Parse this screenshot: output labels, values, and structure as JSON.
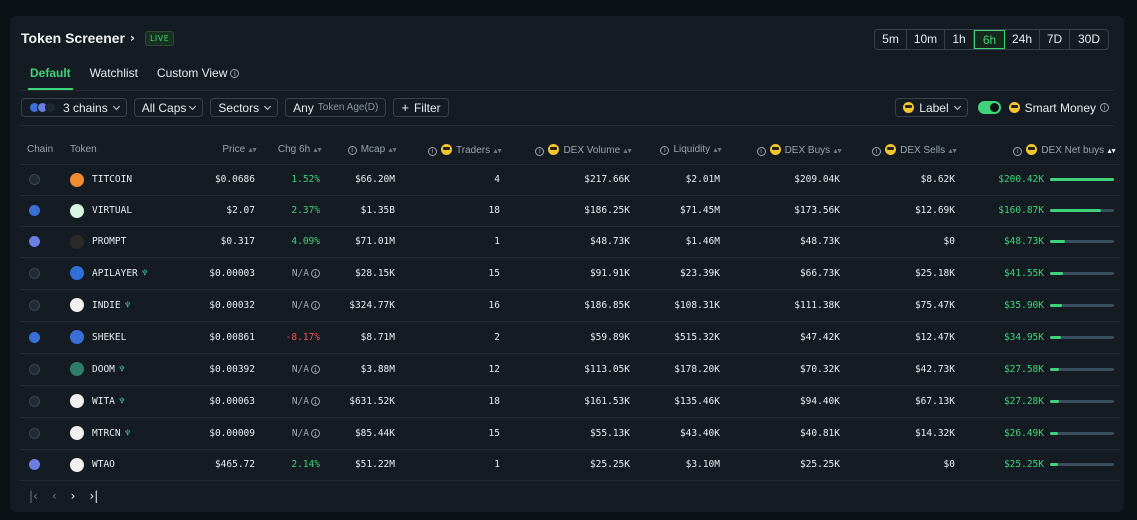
{
  "header": {
    "title": "Token Screener",
    "live_badge": "LIVE",
    "timeframes": [
      "5m",
      "10m",
      "1h",
      "6h",
      "24h",
      "7D",
      "30D"
    ],
    "active_timeframe": "6h"
  },
  "tabs": [
    {
      "label": "Default",
      "active": true
    },
    {
      "label": "Watchlist",
      "active": false
    },
    {
      "label": "Custom View",
      "active": false,
      "info_icon": true
    }
  ],
  "filters": {
    "chains_label": "3 chains",
    "caps_label": "All Caps",
    "sectors_label": "Sectors",
    "token_age_value": "Any",
    "token_age_label": "Token Age(D)",
    "filter_label": "Filter",
    "label_dropdown": "Label",
    "smart_money_label": "Smart Money",
    "smart_money_on": true
  },
  "table": {
    "columns": [
      "Chain",
      "Token",
      "Price",
      "Chg 6h",
      "Mcap",
      "Traders",
      "DEX Volume",
      "Liquidity",
      "DEX Buys",
      "DEX Sells",
      "DEX Net buys"
    ],
    "rows": [
      {
        "chain": "solana",
        "icon_color": "#f28b30",
        "token": "TITCOIN",
        "leaf": false,
        "price": "$0.0686",
        "chg": "1.52%",
        "chg_kind": "pos",
        "mcap": "$66.20M",
        "traders": "4",
        "volume": "$217.66K",
        "liquidity": "$2.01M",
        "buys": "$209.04K",
        "sells": "$8.62K",
        "net": "$200.42K",
        "net_frac": 1.0
      },
      {
        "chain": "base",
        "icon_color": "#d8f5e4",
        "token": "VIRTUAL",
        "leaf": false,
        "price": "$2.07",
        "chg": "2.37%",
        "chg_kind": "pos",
        "mcap": "$1.35B",
        "traders": "18",
        "volume": "$186.25K",
        "liquidity": "$71.45M",
        "buys": "$173.56K",
        "sells": "$12.69K",
        "net": "$160.87K",
        "net_frac": 0.8
      },
      {
        "chain": "ethereum",
        "icon_color": "#2a2a2a",
        "token": "PROMPT",
        "leaf": false,
        "price": "$0.317",
        "chg": "4.09%",
        "chg_kind": "pos",
        "mcap": "$71.01M",
        "traders": "1",
        "volume": "$48.73K",
        "liquidity": "$1.46M",
        "buys": "$48.73K",
        "sells": "$0",
        "net": "$48.73K",
        "net_frac": 0.24
      },
      {
        "chain": "solana",
        "icon_color": "#2f6fd8",
        "token": "APILAYER",
        "leaf": true,
        "price": "$0.00003",
        "chg": "N/A",
        "chg_kind": "na",
        "mcap": "$28.15K",
        "traders": "15",
        "volume": "$91.91K",
        "liquidity": "$23.39K",
        "buys": "$66.73K",
        "sells": "$25.18K",
        "net": "$41.55K",
        "net_frac": 0.21
      },
      {
        "chain": "solana",
        "icon_color": "#f0f0f0",
        "token": "INDIE",
        "leaf": true,
        "price": "$0.00032",
        "chg": "N/A",
        "chg_kind": "na",
        "mcap": "$324.77K",
        "traders": "16",
        "volume": "$186.85K",
        "liquidity": "$108.31K",
        "buys": "$111.38K",
        "sells": "$75.47K",
        "net": "$35.90K",
        "net_frac": 0.18
      },
      {
        "chain": "base",
        "icon_color": "#3a6fd8",
        "token": "SHEKEL",
        "leaf": false,
        "price": "$0.00861",
        "chg": "-8.17%",
        "chg_kind": "neg",
        "mcap": "$8.71M",
        "traders": "2",
        "volume": "$59.89K",
        "liquidity": "$515.32K",
        "buys": "$47.42K",
        "sells": "$12.47K",
        "net": "$34.95K",
        "net_frac": 0.17
      },
      {
        "chain": "solana",
        "icon_color": "#2e7d6a",
        "token": "DOOM",
        "leaf": true,
        "price": "$0.00392",
        "chg": "N/A",
        "chg_kind": "na",
        "mcap": "$3.88M",
        "traders": "12",
        "volume": "$113.05K",
        "liquidity": "$178.20K",
        "buys": "$70.32K",
        "sells": "$42.73K",
        "net": "$27.58K",
        "net_frac": 0.14
      },
      {
        "chain": "solana",
        "icon_color": "#f0f0f0",
        "token": "WITA",
        "leaf": true,
        "price": "$0.00063",
        "chg": "N/A",
        "chg_kind": "na",
        "mcap": "$631.52K",
        "traders": "18",
        "volume": "$161.53K",
        "liquidity": "$135.46K",
        "buys": "$94.40K",
        "sells": "$67.13K",
        "net": "$27.28K",
        "net_frac": 0.14
      },
      {
        "chain": "solana",
        "icon_color": "#f0f0f0",
        "token": "MTRCN",
        "leaf": true,
        "price": "$0.00009",
        "chg": "N/A",
        "chg_kind": "na",
        "mcap": "$85.44K",
        "traders": "15",
        "volume": "$55.13K",
        "liquidity": "$43.40K",
        "buys": "$40.81K",
        "sells": "$14.32K",
        "net": "$26.49K",
        "net_frac": 0.13
      },
      {
        "chain": "ethereum",
        "icon_color": "#f0f0f0",
        "token": "WTAO",
        "leaf": false,
        "price": "$465.72",
        "chg": "2.14%",
        "chg_kind": "pos",
        "mcap": "$51.22M",
        "traders": "1",
        "volume": "$25.25K",
        "liquidity": "$3.10M",
        "buys": "$25.25K",
        "sells": "$0",
        "net": "$25.25K",
        "net_frac": 0.13
      }
    ]
  },
  "colors": {
    "accent": "#3fd37a",
    "negative": "#f0555a",
    "solana": "#1f2a33",
    "base": "#3a6fd8",
    "ethereum": "#6c7ee1"
  }
}
